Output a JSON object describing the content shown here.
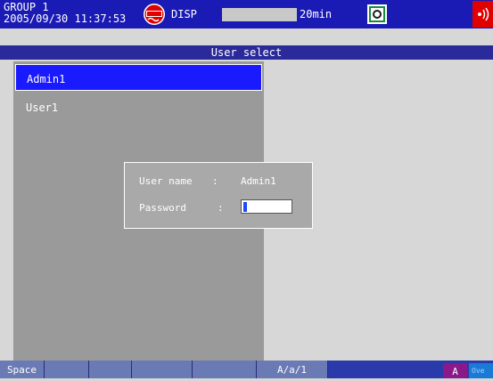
{
  "status": {
    "group": "GROUP 1",
    "datetime": "2005/09/30 11:37:53",
    "disp_label": "DISP",
    "disp_time": "20min"
  },
  "title": "User select",
  "users": [
    {
      "label": "Admin1",
      "selected": true
    },
    {
      "label": "User1",
      "selected": false
    }
  ],
  "dialog": {
    "user_name_label": "User name",
    "separator": ":",
    "user_name_value": "Admin1",
    "password_label": "Password",
    "password_value": ""
  },
  "softkeys": [
    "Space",
    "",
    "",
    "",
    "",
    "A/a/1"
  ],
  "mode_badge": "A",
  "overflow_badge": "Ove",
  "colors": {
    "status_bar": "#1a1ab5",
    "selection": "#1a1aff",
    "alarm": "#e00000"
  }
}
